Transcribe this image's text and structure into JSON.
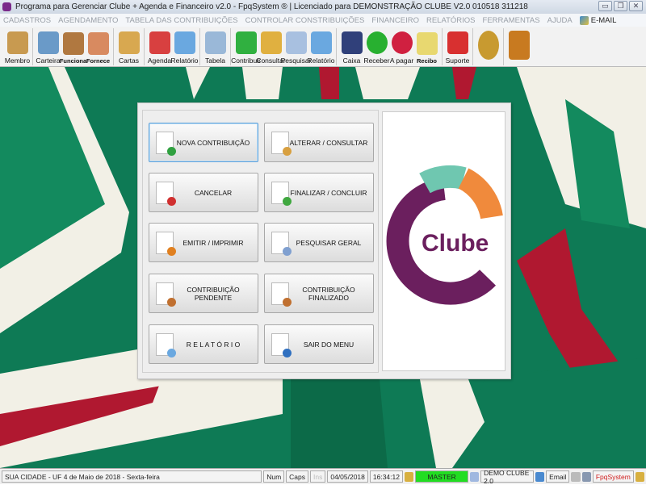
{
  "window": {
    "title": "Programa para Gerenciar Clube + Agenda e Financeiro v2.0 - FpqSystem ® | Licenciado para  DEMONSTRAÇÃO CLUBE V2.0 010518 311218",
    "minimize": "▭",
    "restore": "❐",
    "close": "✕"
  },
  "menu": [
    "CADASTROS",
    "AGENDAMENTO",
    "TABELA DAS CONTRIBUIÇÕES",
    "CONTROLAR CONSTRIBUIÇÕES",
    "FINANCEIRO",
    "RELATÓRIOS",
    "FERRAMENTAS",
    "AJUDA"
  ],
  "menu_email": "E-MAIL",
  "toolbar": [
    {
      "label": "Membro",
      "icon": "members-icon",
      "color": "#c89a50"
    },
    {
      "sep": true
    },
    {
      "label": "Carteira",
      "icon": "id-card-icon",
      "color": "#6a9ac8"
    },
    {
      "label": "Funciona",
      "icon": "employee-icon",
      "color": "#b07840",
      "bold": true
    },
    {
      "label": "Fornece",
      "icon": "supplier-icon",
      "color": "#d88a60",
      "bold": true
    },
    {
      "sep": true
    },
    {
      "label": "Cartas",
      "icon": "letter-scroll-icon",
      "color": "#d8a850"
    },
    {
      "sep": true
    },
    {
      "label": "Agenda",
      "icon": "calendar-icon",
      "color": "#d84040"
    },
    {
      "label": "Relatório",
      "icon": "printer-icon",
      "color": "#6aa8e0"
    },
    {
      "sep": true
    },
    {
      "label": "Tabela",
      "icon": "document-icon",
      "color": "#9ab8d8"
    },
    {
      "sep": true
    },
    {
      "label": "Contribuir",
      "icon": "dollar-icon",
      "color": "#30b040"
    },
    {
      "label": "Consultar",
      "icon": "folder-icon",
      "color": "#e0b040"
    },
    {
      "label": "Pesquisar",
      "icon": "search-icon",
      "color": "#a8c0e0"
    },
    {
      "label": "Relatório",
      "icon": "printer-icon",
      "color": "#6aa8e0"
    },
    {
      "sep": true
    },
    {
      "label": "Caixa",
      "icon": "cash-book-icon",
      "color": "#30407a"
    },
    {
      "label": "Receber",
      "icon": "receive-money-icon",
      "color": "#28b030"
    },
    {
      "label": "A pagar",
      "icon": "pay-money-icon",
      "color": "#d02040"
    },
    {
      "label": "Recibo",
      "icon": "receipt-icon",
      "color": "#e8d870",
      "bold": true
    },
    {
      "sep": true
    },
    {
      "label": "Suporte",
      "icon": "support-icon",
      "color": "#d83030"
    },
    {
      "sep": true
    },
    {
      "label": "",
      "icon": "coin-icon",
      "color": "#c89a30"
    },
    {
      "sep": true
    },
    {
      "label": "",
      "icon": "exit-door-icon",
      "color": "#c87a20"
    }
  ],
  "buttons": [
    {
      "label": "NOVA CONTRIBUIÇÃO",
      "badge": "#30a040"
    },
    {
      "label": "ALTERAR  /  CONSULTAR",
      "badge": "#d8a040"
    },
    {
      "label": "CANCELAR",
      "badge": "#d03030"
    },
    {
      "label": "FINALIZAR  /  CONCLUIR",
      "badge": "#40a840"
    },
    {
      "label": "EMITIR  /  IMPRIMIR",
      "badge": "#e08020"
    },
    {
      "label": "PESQUISAR GERAL",
      "badge": "#80a0d0"
    },
    {
      "label": "CONTRIBUIÇÃO PENDENTE",
      "badge": "#c07030"
    },
    {
      "label": "CONTRIBUIÇÃO FINALIZADO",
      "badge": "#c07030"
    },
    {
      "label": "R E L A T Ó R I O",
      "badge": "#6aa8e0"
    },
    {
      "label": "SAIR DO MENU",
      "badge": "#3070c0"
    }
  ],
  "logo": {
    "text": "Clube",
    "colors": {
      "purple": "#6b1f5e",
      "teal": "#6fc7b0",
      "orange": "#f08a3c"
    }
  },
  "status": {
    "location": "SUA CIDADE - UF  4 de Maio de 2018 - Sexta-feira",
    "num": "Num",
    "caps": "Caps",
    "ins": "Ins",
    "date": "04/05/2018",
    "time": "16:34:12",
    "user": "MASTER",
    "company": "DEMO CLUBE 2.0",
    "email": "Email",
    "brand": "FpqSystem"
  }
}
